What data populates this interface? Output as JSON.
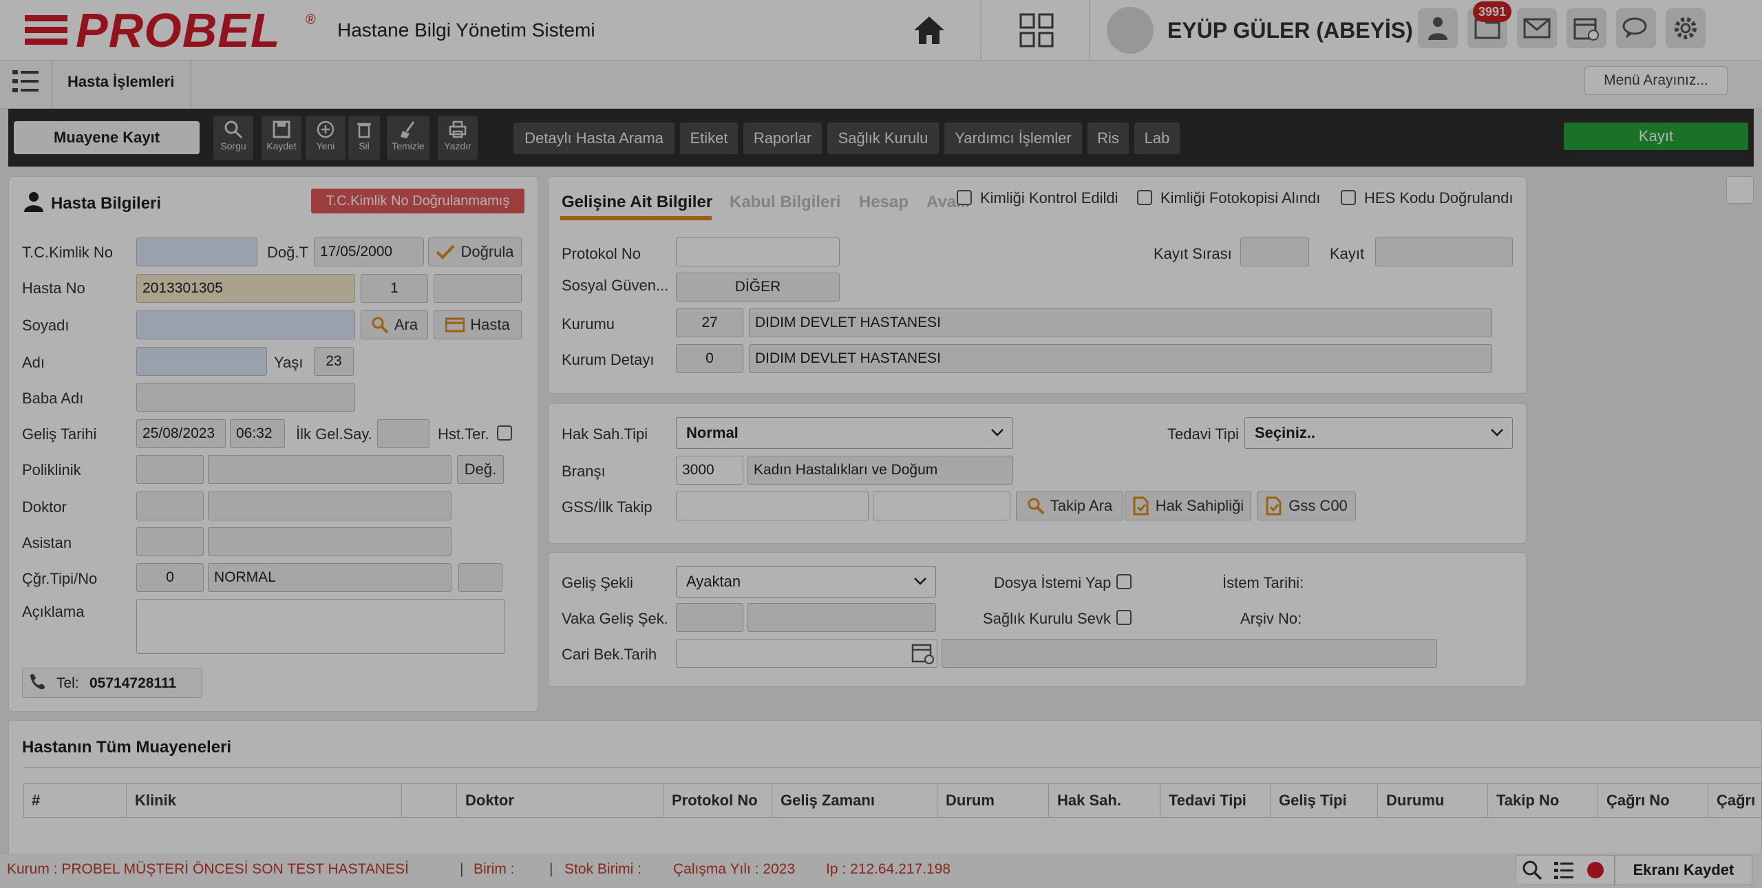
{
  "header": {
    "logo": "PROBEL",
    "logo_mark": "®",
    "app_title": "Hastane Bilgi Yönetim Sistemi",
    "user_name": "EYÜP GÜLER (ABEYİS)",
    "notification_count": "3991"
  },
  "subbar": {
    "breadcrumb": "Hasta İşlemleri",
    "menu_search": "Menü Arayınız..."
  },
  "toolbar": {
    "muayene_kayit": "Muayene Kayıt",
    "buttons": [
      "Sorgu",
      "Kaydet",
      "Yeni",
      "Sil",
      "Temizle",
      "Yazdır"
    ],
    "nav": [
      "Detaylı Hasta Arama",
      "Etiket",
      "Raporlar",
      "Sağlık Kurulu",
      "Yardımcı İşlemler",
      "Ris",
      "Lab"
    ],
    "kayit": "Kayıt"
  },
  "hasta": {
    "title": "Hasta Bilgileri",
    "warning": "T.C.Kimlik No Doğrulanmamış",
    "tc_label": "T.C.Kimlik No",
    "tc_value": "",
    "dog_label": "Doğ.T",
    "dog_value": "17/05/2000",
    "dogrula": "Doğrula",
    "hasta_no_label": "Hasta No",
    "hasta_no": "2013301305",
    "hasta_no_seq": "1",
    "soyadi_label": "Soyadı",
    "ara": "Ara",
    "hasta_btn": "Hasta",
    "adi_label": "Adı",
    "yas_label": "Yaşı",
    "yas": "23",
    "baba_label": "Baba Adı",
    "gelis_label": "Geliş Tarihi",
    "gelis_tarih": "25/08/2023",
    "gelis_saat": "06:32",
    "ilk_label": "İlk Gel.Say.",
    "hst_ter": "Hst.Ter.",
    "poli_label": "Poliklinik",
    "deg": "Değ.",
    "doktor_label": "Doktor",
    "asistan_label": "Asistan",
    "cgr_label": "Çğr.Tipi/No",
    "cgr_no": "0",
    "cgr_tip": "NORMAL",
    "aciklama_label": "Açıklama",
    "tel_label": "Tel:",
    "tel": "05714728111"
  },
  "gelis": {
    "tabs": [
      "Gelişine Ait Bilgiler",
      "Kabul Bilgileri",
      "Hesap",
      "Ava..."
    ],
    "checks": [
      "Kimliği Kontrol Edildi",
      "Kimliği Fotokopisi Alındı",
      "HES Kodu Doğrulandı"
    ],
    "protokol_label": "Protokol No",
    "kayit_sira_label": "Kayıt Sırası",
    "kayit_label": "Kayıt",
    "sosyal_label": "Sosyal Güven...",
    "sosyal_value": "DİĞER",
    "kurum_label": "Kurumu",
    "kurum_code": "27",
    "kurum_name": "DIDIM DEVLET HASTANESI",
    "kurum_detay_label": "Kurum Detayı",
    "kurum_detay_code": "0",
    "kurum_detay_name": "DIDIM DEVLET HASTANESI"
  },
  "hak": {
    "tip_label": "Hak Sah.Tipi",
    "tip_value": "Normal",
    "tedavi_label": "Tedavi Tipi",
    "tedavi_value": "Seçiniz..",
    "brans_label": "Branşı",
    "brans_code": "3000",
    "brans_name": "Kadın Hastalıkları ve Doğum",
    "gss_label": "GSS/İlk Takip",
    "takip_ara": "Takip Ara",
    "hak_sahipligi": "Hak Sahipliği",
    "gss_c00": "Gss C00"
  },
  "gelis2": {
    "sekil_label": "Geliş Şekli",
    "sekil_value": "Ayaktan",
    "dosya_label": "Dosya İstemi Yap",
    "istem_label": "İstem Tarihi:",
    "vaka_label": "Vaka Geliş Şek.",
    "saglik_label": "Sağlık Kurulu Sevk",
    "arsiv_label": "Arşiv No:",
    "cari_label": "Cari Bek.Tarih"
  },
  "muayeneler": {
    "title": "Hastanın Tüm Muayeneleri",
    "columns": [
      "#",
      "Klinik",
      "",
      "Doktor",
      "Protokol No",
      "Geliş Zamanı",
      "Durum",
      "Hak Sah.",
      "Tedavi Tipi",
      "Geliş Tipi",
      "Durumu",
      "Takip No",
      "Çağrı No",
      "Çağrı"
    ]
  },
  "status": {
    "kurum": "Kurum : PROBEL MÜŞTERİ ÖNCESİ SON TEST HASTANESİ",
    "birim": "Birim :",
    "stok": "Stok Birimi :",
    "yil": "Çalışma Yılı : 2023",
    "ip": "Ip : 212.64.217.198",
    "ekran": "Ekranı Kaydet"
  }
}
